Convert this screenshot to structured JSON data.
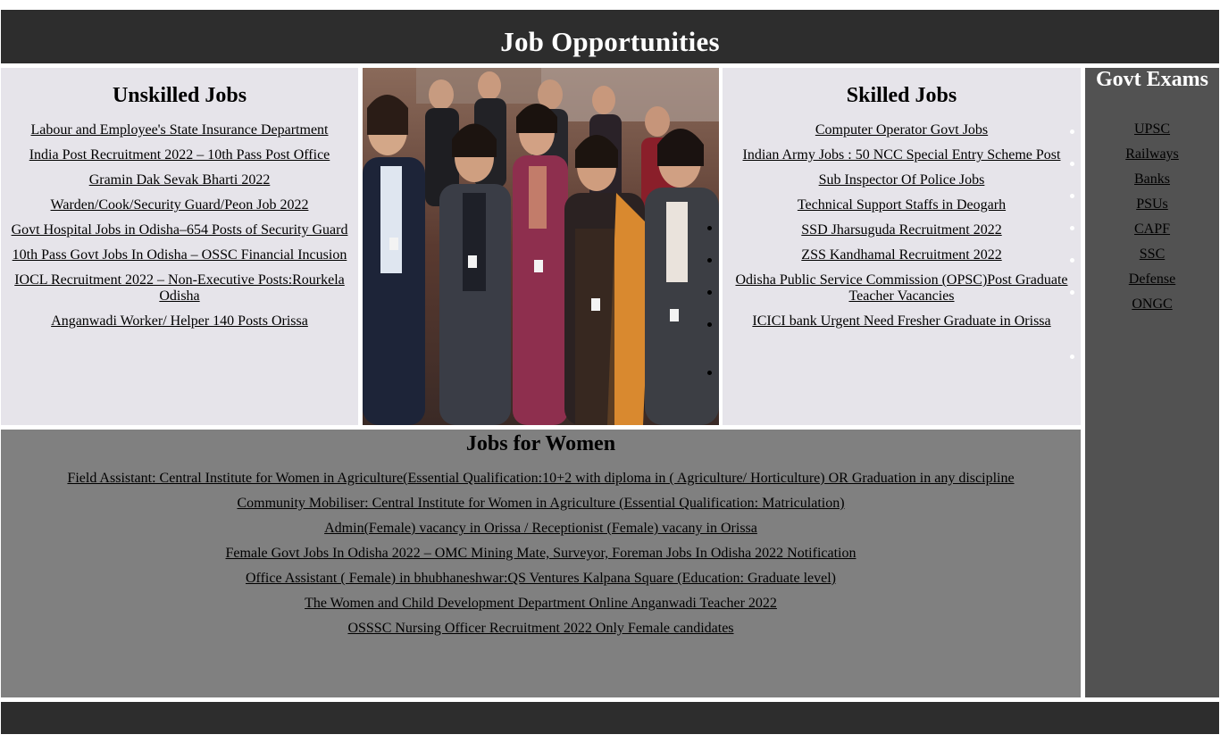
{
  "header": {
    "title": "Job Opportunities"
  },
  "unskilled": {
    "title": "Unskilled Jobs",
    "links": [
      "Labour and Employee's State Insurance Department",
      "India Post Recruitment 2022 – 10th Pass Post Office",
      "Gramin Dak Sevak Bharti 2022",
      "Warden/Cook/Security Guard/Peon Job 2022",
      "Govt Hospital Jobs in Odisha–654 Posts of Security Guard",
      "10th Pass Govt Jobs In Odisha – OSSC Financial Incusion",
      "IOCL Recruitment 2022 – Non-Executive Posts:Rourkela Odisha",
      "Anganwadi Worker/ Helper 140 Posts Orissa"
    ]
  },
  "skilled": {
    "title": "Skilled Jobs",
    "links": [
      "Computer Operator Govt Jobs",
      "Indian Army Jobs : 50 NCC Special Entry Scheme Post",
      "Sub Inspector Of Police Jobs",
      "Technical Support Staffs in Deogarh",
      "SSD Jharsuguda Recruitment 2022",
      "ZSS Kandhamal Recruitment 2022",
      "Odisha Public Service Commission (OPSC)Post Graduate Teacher Vacancies",
      "ICICI bank Urgent Need Fresher Graduate in Orissa"
    ]
  },
  "govt": {
    "title": "Govt Exams",
    "links": [
      "UPSC",
      "Railways",
      "Banks",
      "PSUs",
      "CAPF",
      "SSC",
      "Defense",
      "ONGC"
    ]
  },
  "women": {
    "title": "Jobs for Women",
    "links": [
      "Field Assistant: Central Institute for Women in Agriculture(Essential Qualification:10+2 with diploma in ( Agriculture/ Horticulture) OR Graduation in any discipline",
      "Community Mobiliser: Central Institute for Women in Agriculture (Essential Qualification: Matriculation)",
      "Admin(Female) vacancy in Orissa / Receptionist (Female) vacany in Orissa",
      "Female Govt Jobs In Odisha 2022 – OMC Mining Mate, Surveyor, Foreman Jobs In Odisha 2022 Notification",
      "Office Assistant ( Female) in bhubhaneshwar:QS Ventures Kalpana Square (Education: Graduate level)",
      "The Women and Child Development Department Online Anganwadi Teacher 2022",
      "OSSSC Nursing Officer Recruitment 2022 Only Female candidates"
    ]
  },
  "colors": {
    "header_bg": "#2d2d2d",
    "light_panel": "#e6e4ea",
    "women_panel": "#808080",
    "sidebar": "#525252"
  }
}
